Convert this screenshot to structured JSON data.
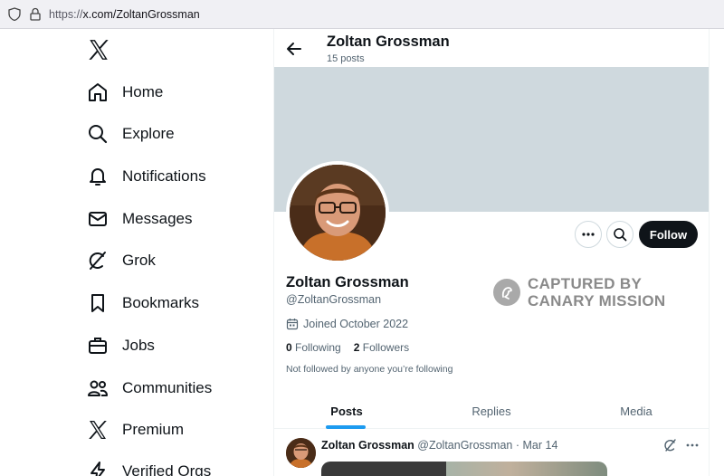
{
  "browser": {
    "url_prefix": "https://",
    "url_main": "x.com/ZoltanGrossman"
  },
  "sidebar": {
    "logo_icon": "x-logo-icon",
    "items": [
      {
        "label": "Home",
        "icon": "home-icon"
      },
      {
        "label": "Explore",
        "icon": "search-icon"
      },
      {
        "label": "Notifications",
        "icon": "bell-icon"
      },
      {
        "label": "Messages",
        "icon": "envelope-icon"
      },
      {
        "label": "Grok",
        "icon": "grok-icon"
      },
      {
        "label": "Bookmarks",
        "icon": "bookmark-icon"
      },
      {
        "label": "Jobs",
        "icon": "briefcase-icon"
      },
      {
        "label": "Communities",
        "icon": "people-icon"
      },
      {
        "label": "Premium",
        "icon": "x-logo-icon"
      },
      {
        "label": "Verified Orgs",
        "icon": "lightning-icon"
      }
    ]
  },
  "header": {
    "name": "Zoltan Grossman",
    "posts_count": "15 posts"
  },
  "profile": {
    "name": "Zoltan Grossman",
    "handle": "@ZoltanGrossman",
    "joined": "Joined October 2022",
    "following_count": "0",
    "following_label": "Following",
    "followers_count": "2",
    "followers_label": "Followers",
    "not_followed": "Not followed by anyone you’re following",
    "follow_button": "Follow"
  },
  "watermark": {
    "line1": "CAPTURED BY",
    "line2": "CANARY MISSION"
  },
  "tabs": [
    {
      "label": "Posts",
      "active": true
    },
    {
      "label": "Replies",
      "active": false
    },
    {
      "label": "Media",
      "active": false
    }
  ],
  "post": {
    "name": "Zoltan Grossman",
    "handle": "@ZoltanGrossman",
    "separator": "·",
    "date": "Mar 14"
  },
  "colors": {
    "banner": "#cfd9de",
    "accent": "#1d9bf0",
    "follow_button": "#0f1419"
  }
}
